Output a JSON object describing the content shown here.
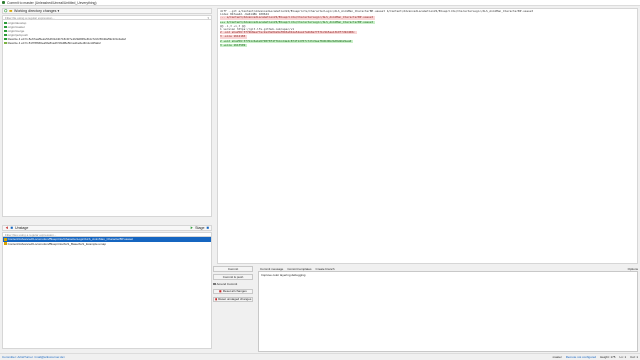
{
  "window": {
    "title": "Commit to master (Unleashed\\Unreal\\Untitled_Ueverything)"
  },
  "left": {
    "toolbar_label": "Working directory changes",
    "filter_placeholder": "Filter file using a regular expression...",
    "tree": [
      {
        "label": "origin/develop",
        "color": "#2e9d3a",
        "kind": "remote"
      },
      {
        "label": "origin/master",
        "color": "#2e9d3a",
        "kind": "remote"
      },
      {
        "label": "origin/merge",
        "color": "#2e9d3a",
        "kind": "remote"
      },
      {
        "label": "origin/pull-push",
        "color": "#2e9d3a",
        "kind": "remote"
      },
      {
        "label": "Rewrite 4 e0 f1 8e67aaf5e2e5b4f31d4b71ffc4f7e1f29d845efb4c72cfc5640a59c1f4c4a3ef",
        "color": "#2e9d3a",
        "kind": "hash"
      },
      {
        "label": "Rewrite 4 e0 f1 81f7f8666ea5fe81a2f7d9df8e5b1a1be6e3b11cd25ab2",
        "color": "#7cb342",
        "kind": "hash"
      }
    ],
    "staging": {
      "label": "Unstage",
      "right_label": "Stage"
    },
    "staging_filter_placeholder": "Filter files using a regular expression...",
    "files": [
      {
        "label": "Content/Advanced/Locomotion/Blueprints/CharacterLogic/ALS_AnimMan_CharacterBP.uasset",
        "selected": true
      },
      {
        "label": "Content/Advanced/Locomotion/Blueprints/ALS_Base/ALS_Example.umap",
        "selected": false
      }
    ]
  },
  "diff": {
    "lines": [
      {
        "type": "hdr",
        "text": "diff --git a/Content/AdvancedLocomotionV4/Blueprints/CharacterLogic/ALS_AnimMan_CharacterBP.uasset b/Content/AdvancedLocomotionV4/Blueprints/CharacterLogic/ALS_AnimMan_CharacterBP.uasset"
      },
      {
        "type": "hdr",
        "text": "index 8b7aa42..6e6148b 100644"
      },
      {
        "type": "minus",
        "text": "--- a/Content/AdvancedLocomotionV4/Blueprints/CharacterLogic/ALS_AnimMan_CharacterBP.uasset"
      },
      {
        "type": "plus",
        "text": "+++ b/Content/AdvancedLocomotionV4/Blueprints/CharacterLogic/ALS_AnimMan_CharacterBP.uasset"
      },
      {
        "type": "hunk",
        "text": "@@ -1,3 +1,3 @@"
      },
      {
        "type": "hdr",
        "text": "1  version https://git-lfs.github.com/spec/v1"
      },
      {
        "type": "minus",
        "text": "2 -oid sha256:5f72b8ea77ac2ed3e04a9af8b5e0b1e54aa1fa2b8e7f37bc9b5ae13b9f7d9d408c"
      },
      {
        "type": "minus",
        "text": "3 -size 1612165"
      },
      {
        "type": "plus",
        "text": "2 +oid sha256:5f7b1c6eba5f90f8f4f7b4cd4e4c874f1d70fc7d3c9eaf8d6d9b2bd8a9b2bea0"
      },
      {
        "type": "plus",
        "text": "3 +size 1613509"
      }
    ]
  },
  "commit": {
    "commit_label": "Commit",
    "commit_push_label": "Commit & push",
    "amend_label": "Amend Commit",
    "reset_all_label": "Reset all changes",
    "stage_all_label": "Reset unstaged changes",
    "toolbar": {
      "messages_label": "Commit message",
      "templates_label": "Commit templates",
      "create_branch_label": "Create branch",
      "options_label": "Options"
    },
    "message": "Improve color layering debugging"
  },
  "status": {
    "author": "Committer: ArtistTurner <mail@artist-turner.de>",
    "branch": "master",
    "remote": "Remote not configured",
    "encoding": "Ln: 1",
    "position": "Col: 1",
    "size": "Height: 175"
  }
}
